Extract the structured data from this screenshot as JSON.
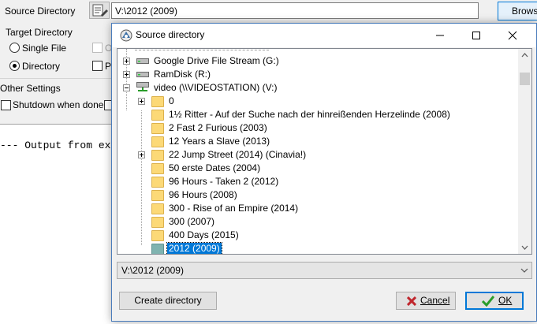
{
  "main": {
    "source_label": "Source Directory",
    "source_path": "V:\\2012 (2009)",
    "browse_label": "Browse",
    "target_label": "Target Directory",
    "single_file_label": "Single File",
    "directory_label": "Directory",
    "target_option_o": "O",
    "target_option_pr": "Pr",
    "other_settings_label": "Other Settings",
    "shutdown_label": "Shutdown when done",
    "output_text": "--- Output from ex"
  },
  "dialog": {
    "title": "Source directory",
    "tree": [
      {
        "label": "Google Drive File Stream (G:)",
        "type": "drive",
        "expander": "plus"
      },
      {
        "label": "RamDisk (R:)",
        "type": "drive",
        "expander": "plus"
      },
      {
        "label": "video (\\\\VIDEOSTATION) (V:)",
        "type": "network-drive",
        "expander": "minus"
      },
      {
        "label": "0",
        "type": "folder",
        "expander": "plus"
      },
      {
        "label": "1½ Ritter - Auf der Suche nach der hinreißenden Herzelinde (2008)",
        "type": "folder"
      },
      {
        "label": "2 Fast 2 Furious (2003)",
        "type": "folder"
      },
      {
        "label": "12 Years a Slave (2013)",
        "type": "folder"
      },
      {
        "label": "22 Jump Street (2014) (Cinavia!)",
        "type": "folder",
        "expander": "plus"
      },
      {
        "label": "50 erste Dates (2004)",
        "type": "folder"
      },
      {
        "label": "96 Hours - Taken 2 (2012)",
        "type": "folder"
      },
      {
        "label": "96 Hours (2008)",
        "type": "folder"
      },
      {
        "label": "300 - Rise of an Empire (2014)",
        "type": "folder"
      },
      {
        "label": "300 (2007)",
        "type": "folder"
      },
      {
        "label": "400 Days (2015)",
        "type": "folder"
      },
      {
        "label": "2012 (2009)",
        "type": "folder",
        "selected": true
      }
    ],
    "path_value": "V:\\2012 (2009)",
    "create_label": "Create directory",
    "cancel_label": "Cancel",
    "ok_label": "OK"
  },
  "colors": {
    "accent": "#0078d7",
    "folder": "#fcd977",
    "cancel_icon": "#c0262d",
    "ok_icon": "#2a9d2a"
  }
}
